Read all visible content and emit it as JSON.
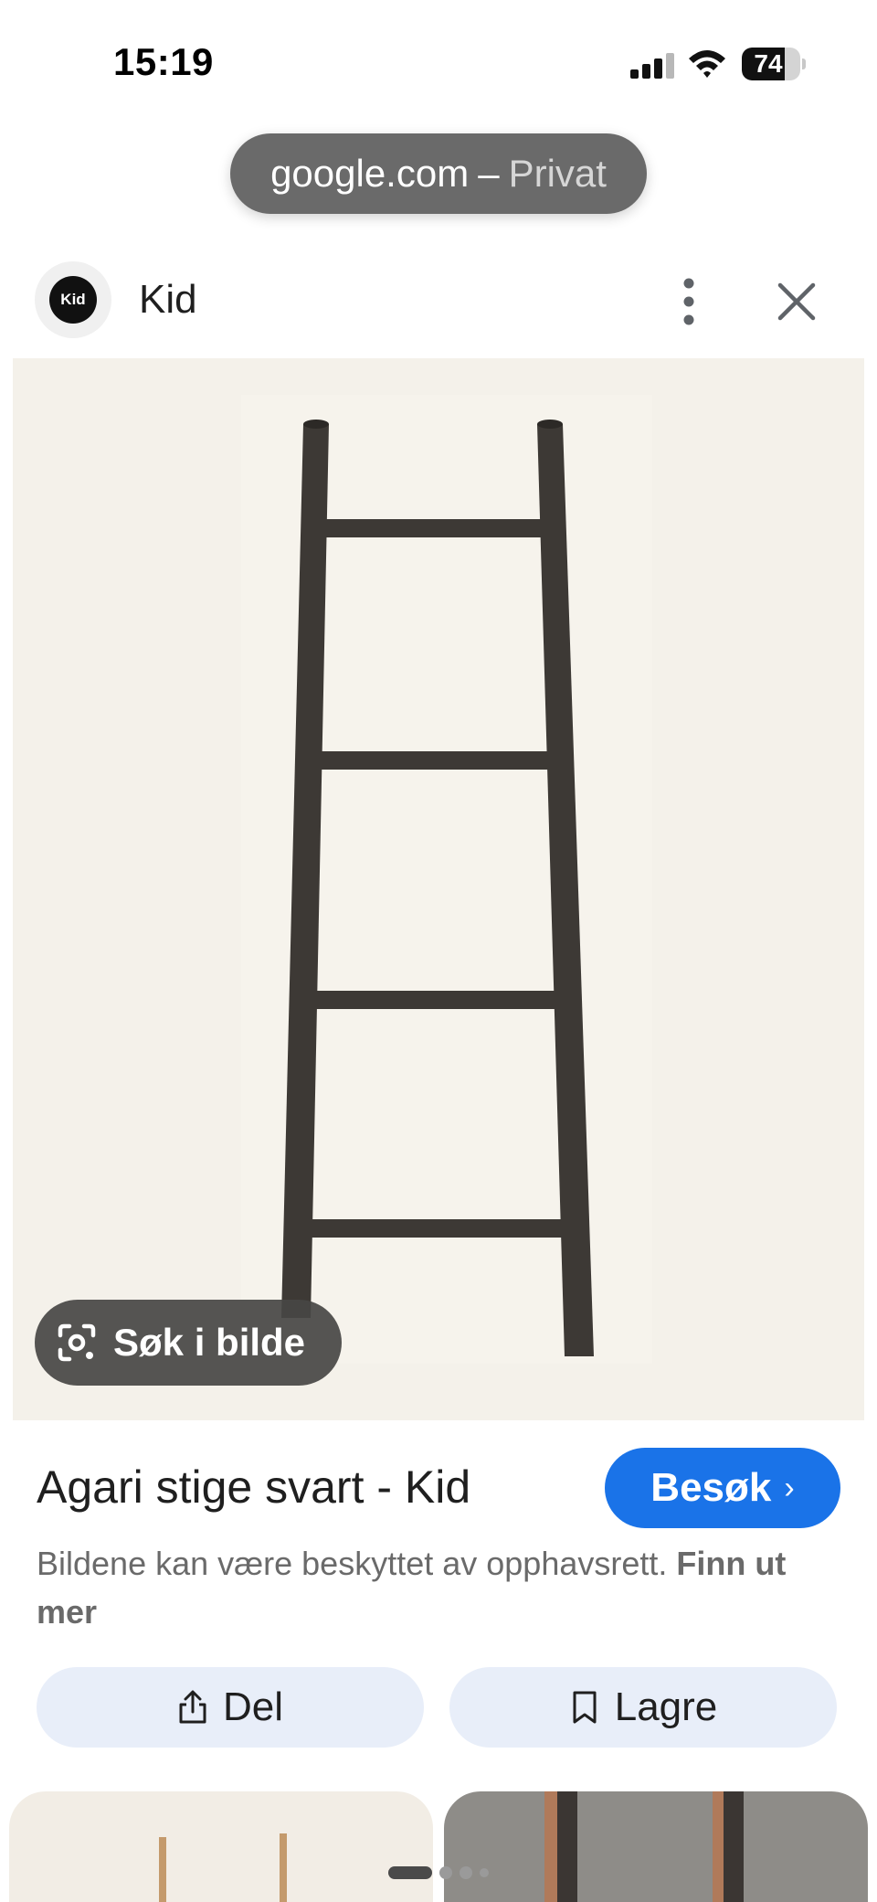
{
  "status_bar": {
    "time": "15:19",
    "battery": "74",
    "battery_level": 0.74,
    "icons": [
      "signal-icon",
      "wifi-icon",
      "battery-icon"
    ]
  },
  "url_bar": {
    "host": "google.com",
    "separator": "–",
    "mode": "Privat"
  },
  "source": {
    "logo_text": "Kid",
    "name": "Kid",
    "icons": [
      "more-vertical-icon",
      "close-icon"
    ]
  },
  "image": {
    "lens_button_label": "Søk i bilde",
    "icon": "google-lens-icon",
    "background": "#f4f1ea",
    "ladder_color": "#3d3935"
  },
  "result": {
    "title": "Agari stige svart - Kid",
    "visit_label": "Besøk",
    "visit_chevron": "›",
    "copyright_text": "Bildene kan være beskyttet av opphavsrett.",
    "learn_more": "Finn ut mer"
  },
  "actions": {
    "share_label": "Del",
    "save_label": "Lagre",
    "icons": [
      "share-icon",
      "bookmark-icon"
    ]
  },
  "colors": {
    "accent": "#1a73e8",
    "action_bg": "#e8eef9",
    "pill_bg": "#6a6a6a"
  }
}
